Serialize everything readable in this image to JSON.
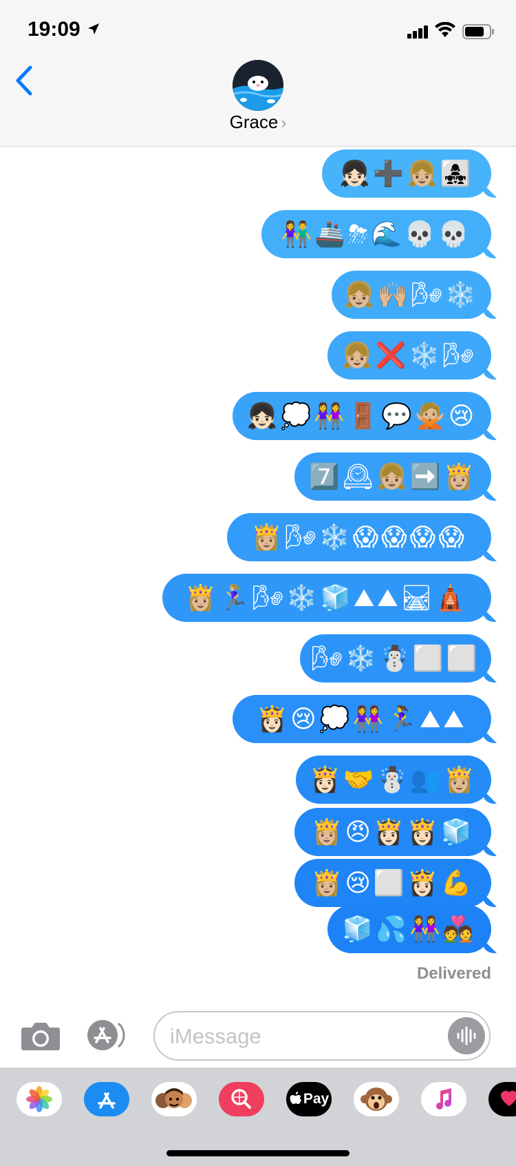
{
  "status_bar": {
    "time": "19:09"
  },
  "conversation": {
    "contact_name": "Grace",
    "name_chevron": "›"
  },
  "messages": [
    {
      "text": "👧🏻➕👧🏼👩‍👧‍👧"
    },
    {
      "text": "👫🚢⛈🌊💀💀"
    },
    {
      "text": "👧🏼🙌🏼🌬❄️"
    },
    {
      "text": "👧🏼❌❄️🌬"
    },
    {
      "text": "👧🏻💭👭🚪💬🙅🏼😢"
    },
    {
      "text": "7️⃣🕰👧🏼➡️👸🏼"
    },
    {
      "text": "👸🏼🌬❄️😱😱😱😱"
    },
    {
      "text": "👸🏼🏃🏼‍♀️🌬❄️🧊⛰⛰🛤🛕"
    },
    {
      "text": "🌬❄️☃️⬜⬜"
    },
    {
      "text": "👸🏻😢💭👭🏃‍♀️⛰⛰"
    },
    {
      "text": "👸🏻🤝☃️👥👸🏼"
    },
    {
      "text": "👸🏼😠👸🏻👸🏻🧊"
    },
    {
      "text": "👸🏼😢⬜👸🏻💪"
    },
    {
      "text": "🧊💦👭💑"
    }
  ],
  "delivery_status": "Delivered",
  "composer": {
    "placeholder": "iMessage"
  },
  "app_drawer": [
    {
      "name": "photos",
      "color": "#ffffff"
    },
    {
      "name": "app-store",
      "color": "#1d8cf2"
    },
    {
      "name": "memoji-stickers",
      "color": "#ffffff"
    },
    {
      "name": "search-images",
      "color": "#f03e5e"
    },
    {
      "name": "apple-pay",
      "color": "#000000",
      "label": "Pay"
    },
    {
      "name": "animoji",
      "color": "#ffffff"
    },
    {
      "name": "music",
      "color": "#ffffff"
    },
    {
      "name": "digital-touch",
      "color": "#000000"
    }
  ],
  "colors": {
    "bubble_top": "#47b3fb",
    "bubble_bottom": "#1a7ff6",
    "accent": "#0a7aff"
  }
}
